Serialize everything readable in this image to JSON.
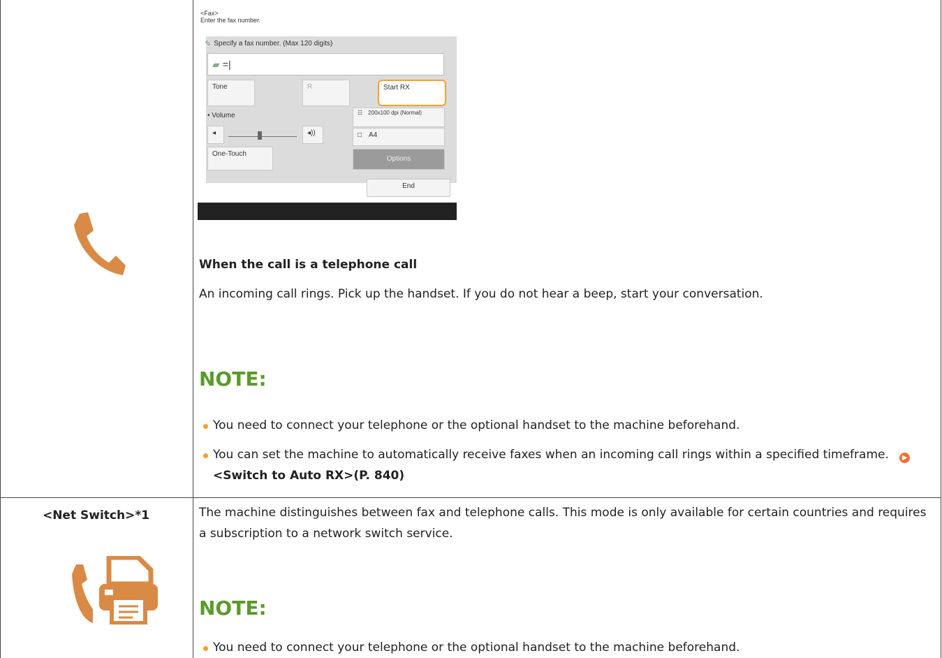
{
  "panel": {
    "breadcrumb": "<Fax>",
    "instruction": "Enter the fax number.",
    "header": "Specify a fax number. (Max 120 digits)",
    "field_value": "=|",
    "tone": "Tone",
    "r": "R",
    "start_rx": "Start RX",
    "volume": "Volume",
    "resolution": "200x100 dpi (Normal)",
    "paper": "A4",
    "one_touch": "One-Touch",
    "options": "Options",
    "end": "End"
  },
  "section1": {
    "heading": "When the call is a telephone call",
    "text": "An incoming call rings. Pick up the handset. If you do not hear a beep, start your conversation.",
    "note_title": "NOTE:",
    "bullets": [
      "You need to connect your telephone or the optional handset to the machine beforehand.",
      "You can set the machine to automatically receive faxes when an incoming call rings within a specified timeframe."
    ],
    "link": "<Switch to Auto RX>(P. 840)"
  },
  "section2": {
    "label": "<Net Switch>*1",
    "text": "The machine distinguishes between fax and telephone calls. This mode is only available for certain countries and requires a subscription to a network switch service.",
    "note_title": "NOTE:",
    "bullet": "You need to connect your telephone or the optional handset to the machine beforehand."
  },
  "colors": {
    "accent": "#f5a030",
    "icon": "#d98a45",
    "note": "#5a9a2a"
  }
}
